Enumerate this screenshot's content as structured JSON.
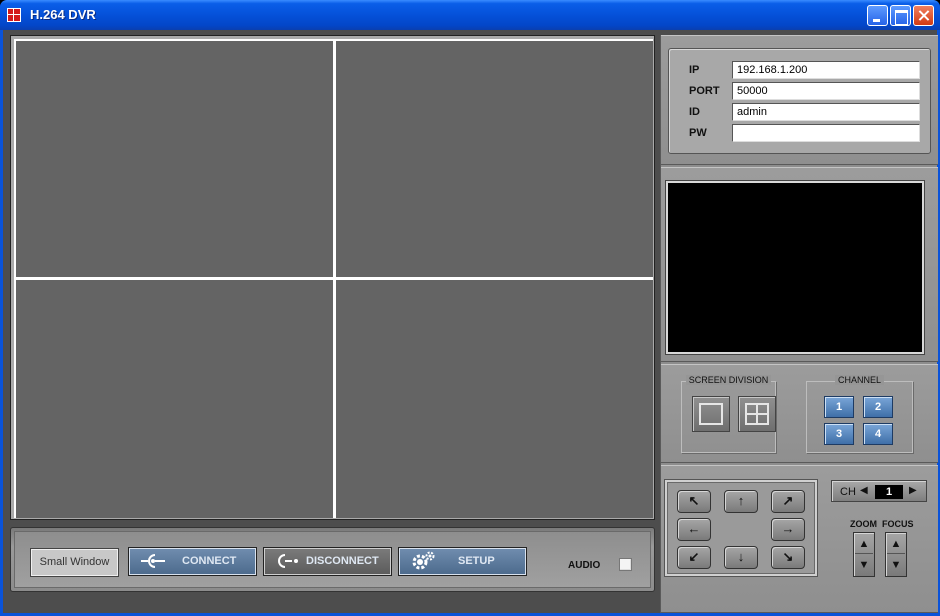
{
  "window": {
    "title": "H.264 DVR"
  },
  "toolbar": {
    "small_window_label": "Small Window",
    "connect_label": "CONNECT",
    "disconnect_label": "DISCONNECT",
    "setup_label": "SETUP",
    "audio_label": "AUDIO",
    "audio_checked": false
  },
  "login": {
    "ip_label": "IP",
    "ip_value": "192.168.1.200",
    "port_label": "PORT",
    "port_value": "50000",
    "id_label": "ID",
    "id_value": "admin",
    "pw_label": "PW",
    "pw_value": ""
  },
  "screen_division": {
    "title": "SCREEN DIVISION"
  },
  "channel": {
    "title": "CHANNEL",
    "buttons": [
      "1",
      "2",
      "3",
      "4"
    ]
  },
  "ptz": {
    "ch_label": "CH",
    "ch_value": "1",
    "zoom_label": "ZOOM",
    "focus_label": "FOCUS",
    "arrows": {
      "up_left": "↖",
      "up": "↑",
      "up_right": "↗",
      "left": "←",
      "right": "→",
      "down_left": "↙",
      "down": "↓",
      "down_right": "↘",
      "small_left": "◀",
      "small_right": "▶",
      "zoom_up": "▲",
      "zoom_down": "▼"
    }
  },
  "colors": {
    "title_bar": "#0551d9",
    "video_cell": "#646464",
    "accent_button": "#4d6b8d",
    "channel_button": "#3f6fa8"
  }
}
